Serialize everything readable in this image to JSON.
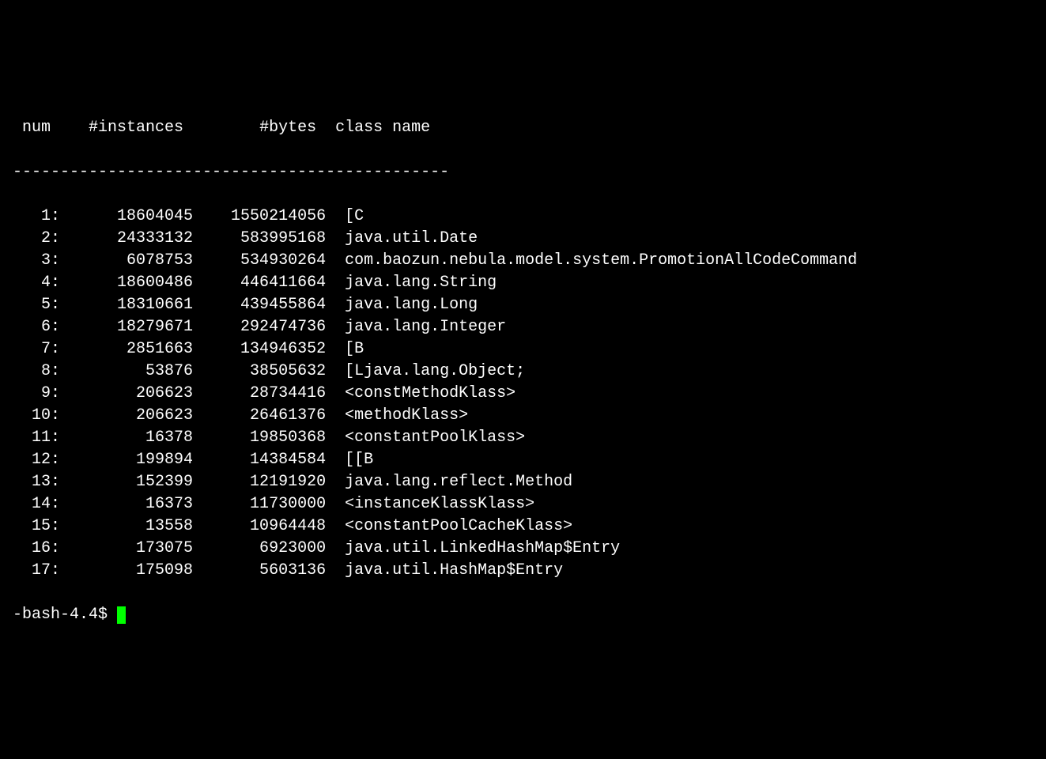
{
  "header": {
    "num": " num",
    "instances": "    #instances",
    "bytes": "        #bytes",
    "className": "  class name"
  },
  "separator": "----------------------------------------------",
  "rows": [
    {
      "num": "   1:",
      "instances": "      18604045",
      "bytes": "    1550214056",
      "className": "  [C"
    },
    {
      "num": "   2:",
      "instances": "      24333132",
      "bytes": "     583995168",
      "className": "  java.util.Date"
    },
    {
      "num": "   3:",
      "instances": "       6078753",
      "bytes": "     534930264",
      "className": "  com.baozun.nebula.model.system.PromotionAllCodeCommand"
    },
    {
      "num": "   4:",
      "instances": "      18600486",
      "bytes": "     446411664",
      "className": "  java.lang.String"
    },
    {
      "num": "   5:",
      "instances": "      18310661",
      "bytes": "     439455864",
      "className": "  java.lang.Long"
    },
    {
      "num": "   6:",
      "instances": "      18279671",
      "bytes": "     292474736",
      "className": "  java.lang.Integer"
    },
    {
      "num": "   7:",
      "instances": "       2851663",
      "bytes": "     134946352",
      "className": "  [B"
    },
    {
      "num": "   8:",
      "instances": "         53876",
      "bytes": "      38505632",
      "className": "  [Ljava.lang.Object;"
    },
    {
      "num": "   9:",
      "instances": "        206623",
      "bytes": "      28734416",
      "className": "  <constMethodKlass>"
    },
    {
      "num": "  10:",
      "instances": "        206623",
      "bytes": "      26461376",
      "className": "  <methodKlass>"
    },
    {
      "num": "  11:",
      "instances": "         16378",
      "bytes": "      19850368",
      "className": "  <constantPoolKlass>"
    },
    {
      "num": "  12:",
      "instances": "        199894",
      "bytes": "      14384584",
      "className": "  [[B"
    },
    {
      "num": "  13:",
      "instances": "        152399",
      "bytes": "      12191920",
      "className": "  java.lang.reflect.Method"
    },
    {
      "num": "  14:",
      "instances": "         16373",
      "bytes": "      11730000",
      "className": "  <instanceKlassKlass>"
    },
    {
      "num": "  15:",
      "instances": "         13558",
      "bytes": "      10964448",
      "className": "  <constantPoolCacheKlass>"
    },
    {
      "num": "  16:",
      "instances": "        173075",
      "bytes": "       6923000",
      "className": "  java.util.LinkedHashMap$Entry"
    },
    {
      "num": "  17:",
      "instances": "        175098",
      "bytes": "       5603136",
      "className": "  java.util.HashMap$Entry"
    }
  ],
  "prompt": "-bash-4.4$ "
}
